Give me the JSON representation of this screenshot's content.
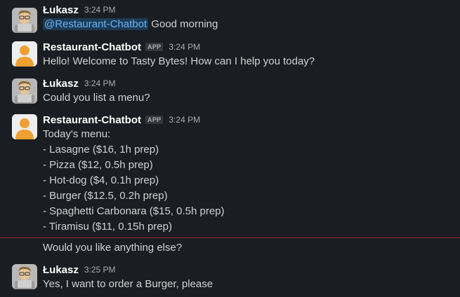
{
  "messages": [
    {
      "author": "Łukasz",
      "time": "3:24 PM",
      "mention": "@Restaurant-Chatbot",
      "text": " Good morning"
    },
    {
      "author": "Restaurant-Chatbot",
      "badge": "APP",
      "time": "3:24 PM",
      "text": "Hello! Welcome to Tasty Bytes! How can I help you today?"
    },
    {
      "author": "Łukasz",
      "time": "3:24 PM",
      "text": "Could you list a menu?"
    },
    {
      "author": "Restaurant-Chatbot",
      "badge": "APP",
      "time": "3:24 PM",
      "lines": [
        "Today's menu:",
        "- Lasagne ($16, 1h prep)",
        "- Pizza ($12, 0.5h prep)",
        "- Hot-dog ($4, 0.1h prep)",
        "- Burger ($12.5, 0.2h prep)",
        "- Spaghetti Carbonara ($15, 0.5h prep)",
        "- Tiramisu ($11, 0.15h prep)"
      ],
      "followup": "Would you like anything else?"
    },
    {
      "author": "Łukasz",
      "time": "3:25 PM",
      "text": "Yes, I want to order a Burger, please"
    }
  ],
  "colors": {
    "background": "#1a1d21",
    "mention_bg": "#1d3b55",
    "mention_text": "#68b3f5",
    "new_divider": "#8c2f2f",
    "bot_avatar": "#f0a030"
  },
  "icons": {
    "user_avatar": "user-avatar-icon",
    "bot_avatar": "bot-avatar-icon"
  }
}
